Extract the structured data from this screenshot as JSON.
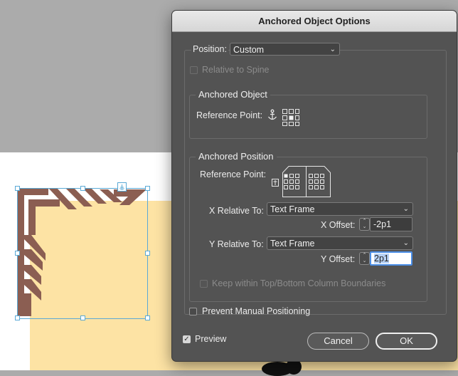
{
  "dialog": {
    "title": "Anchored Object Options",
    "position_label": "Position:",
    "position_value": "Custom",
    "relative_to_spine_label": "Relative to Spine",
    "anchored_object": {
      "legend": "Anchored Object",
      "reference_point_label": "Reference Point:"
    },
    "anchored_position": {
      "legend": "Anchored Position",
      "reference_point_label": "Reference Point:",
      "x_relative_label": "X Relative To:",
      "x_relative_value": "Text Frame",
      "x_offset_label": "X Offset:",
      "x_offset_value": "-2p1",
      "y_relative_label": "Y Relative To:",
      "y_relative_value": "Text Frame",
      "y_offset_label": "Y Offset:",
      "y_offset_value": "2p1",
      "keep_within_label": "Keep within Top/Bottom Column Boundaries"
    },
    "prevent_manual_label": "Prevent Manual Positioning",
    "preview_label": "Preview",
    "preview_checked": true,
    "cancel_label": "Cancel",
    "ok_label": "OK"
  },
  "colors": {
    "ornament": "#8b5e52",
    "frame_fill": "#fde3a4",
    "selection": "#5aa9d6"
  },
  "icons": {
    "anchor": "anchor-icon",
    "proxy_grid": "reference-point-proxy-icon",
    "spread": "spread-proxy-icon",
    "chevron": "chevron-down-icon",
    "stepper": "stepper-icon",
    "checkmark": "checkmark-icon"
  }
}
